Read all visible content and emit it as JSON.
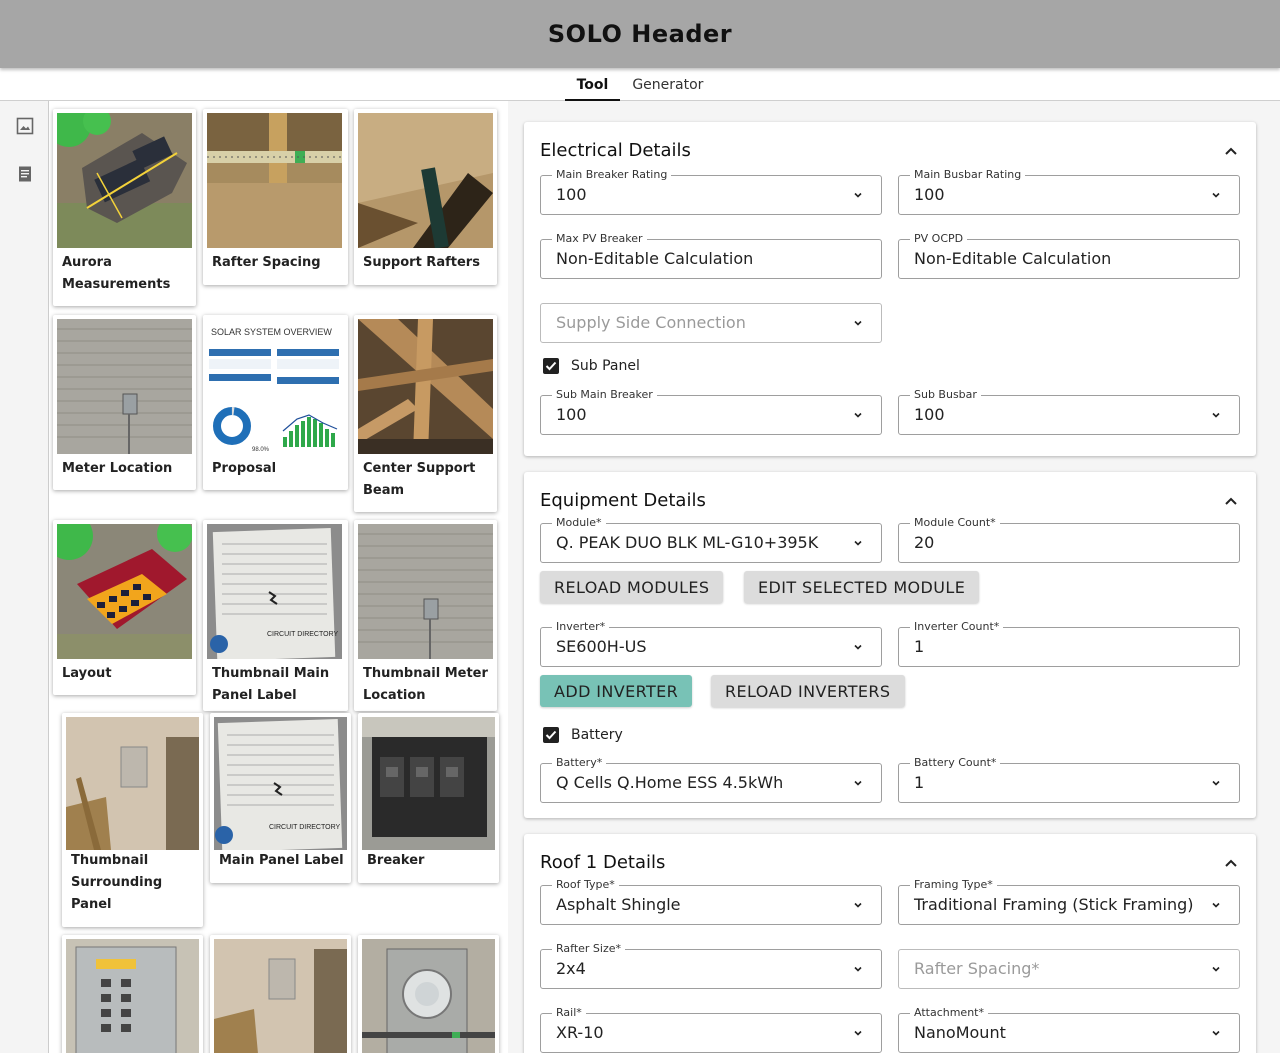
{
  "header": {
    "title": "SOLO Header"
  },
  "tabs": [
    {
      "label": "Tool"
    },
    {
      "label": "Generator"
    }
  ],
  "rail": {
    "icons": [
      "image-icon",
      "document-icon"
    ]
  },
  "gallery": {
    "cards": [
      {
        "caption": "Aurora Measurements"
      },
      {
        "caption": "Rafter Spacing"
      },
      {
        "caption": "Support Rafters"
      },
      {
        "caption": "Meter Location"
      },
      {
        "caption": "Proposal",
        "image_text": {
          "title": "SOLAR SYSTEM OVERVIEW",
          "pct": "98.0%"
        }
      },
      {
        "caption": "Center Support Beam"
      },
      {
        "caption": "Layout"
      },
      {
        "caption": "Thumbnail Main Panel Label",
        "image_text": "CIRCUIT DIRECTORY"
      },
      {
        "caption": "Thumbnail Meter Location"
      },
      {
        "caption": "Thumbnail Surrounding Panel"
      },
      {
        "caption": "Main Panel Label",
        "image_text": "CIRCUIT DIRECTORY"
      },
      {
        "caption": "Breaker"
      },
      {
        "caption": ""
      },
      {
        "caption": ""
      },
      {
        "caption": ""
      }
    ]
  },
  "electrical": {
    "title": "Electrical Details",
    "main_breaker": {
      "label": "Main Breaker Rating",
      "value": "100"
    },
    "main_busbar": {
      "label": "Main Busbar Rating",
      "value": "100"
    },
    "max_pv_breaker": {
      "label": "Max PV Breaker",
      "value": "Non-Editable Calculation"
    },
    "pv_ocpd": {
      "label": "PV OCPD",
      "value": "Non-Editable Calculation"
    },
    "supply_side": {
      "placeholder": "Supply Side Connection"
    },
    "sub_panel": {
      "label": "Sub Panel",
      "checked": true
    },
    "sub_main_breaker": {
      "label": "Sub Main Breaker",
      "value": "100"
    },
    "sub_busbar": {
      "label": "Sub Busbar",
      "value": "100"
    }
  },
  "equipment": {
    "title": "Equipment Details",
    "module": {
      "label": "Module*",
      "value": "Q. PEAK DUO BLK ML-G10+395K"
    },
    "module_count": {
      "label": "Module Count*",
      "value": "20"
    },
    "reload_modules": "RELOAD MODULES",
    "edit_module": "EDIT SELECTED MODULE",
    "inverter": {
      "label": "Inverter*",
      "value": "SE600H-US"
    },
    "inverter_count": {
      "label": "Inverter Count*",
      "value": "1"
    },
    "add_inverter": "ADD INVERTER",
    "reload_inverters": "RELOAD INVERTERS",
    "battery_check": {
      "label": "Battery",
      "checked": true
    },
    "battery": {
      "label": "Battery*",
      "value": "Q Cells Q.Home ESS 4.5kWh"
    },
    "battery_count": {
      "label": "Battery Count*",
      "value": "1"
    }
  },
  "roof": {
    "title": "Roof 1 Details",
    "roof_type": {
      "label": "Roof Type*",
      "value": "Asphalt Shingle"
    },
    "framing_type": {
      "label": "Framing Type*",
      "value": "Traditional Framing (Stick Framing)"
    },
    "rafter_size": {
      "label": "Rafter Size*",
      "value": "2x4"
    },
    "rafter_spacing": {
      "placeholder": "Rafter Spacing*"
    },
    "rail": {
      "label": "Rail*",
      "value": "XR-10"
    },
    "attachment": {
      "label": "Attachment*",
      "value": "NanoMount"
    }
  },
  "colors": {
    "header_bg": "#a6a6a6",
    "teal_button": "#78c2b6",
    "grey_button": "#dcdcdc"
  }
}
